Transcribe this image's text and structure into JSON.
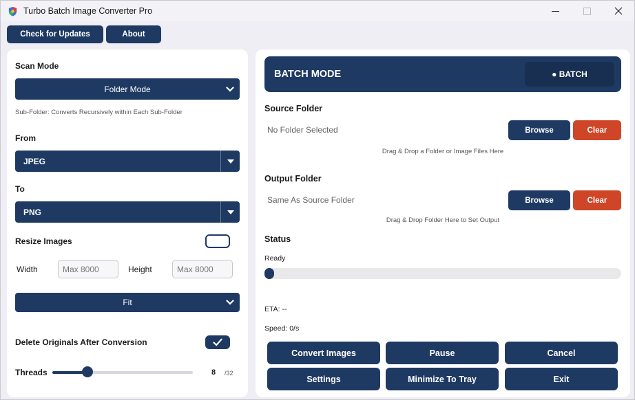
{
  "window": {
    "title": "Turbo Batch Image Converter Pro"
  },
  "top_buttons": {
    "check_updates": "Check for Updates",
    "about": "About"
  },
  "left": {
    "scan_mode_label": "Scan Mode",
    "scan_mode_value": "Folder Mode",
    "scan_mode_hint": "Sub-Folder: Converts Recursively within Each Sub-Folder",
    "from_label": "From",
    "from_value": "JPEG",
    "to_label": "To",
    "to_value": "PNG",
    "resize_label": "Resize Images",
    "resize_enabled": false,
    "width_label": "Width",
    "width_placeholder": "Max 8000",
    "height_label": "Height",
    "height_placeholder": "Max 8000",
    "fit_value": "Fit",
    "delete_originals_label": "Delete Originals After Conversion",
    "delete_originals_enabled": true,
    "threads_label": "Threads",
    "threads_value": "8",
    "threads_max": "/32",
    "threads_fraction": 0.25
  },
  "right": {
    "banner_title": "BATCH MODE",
    "batch_pill": "● BATCH",
    "source_label": "Source Folder",
    "source_value": "No Folder Selected",
    "source_browse": "Browse",
    "source_clear": "Clear",
    "source_hint": "Drag & Drop a Folder or Image Files Here",
    "output_label": "Output Folder",
    "output_value": "Same As Source Folder",
    "output_browse": "Browse",
    "output_clear": "Clear",
    "output_hint": "Drag & Drop Folder Here to Set Output",
    "status_label": "Status",
    "status_value": "Ready",
    "progress": 0,
    "eta": "ETA: --",
    "speed": "Speed: 0/s",
    "actions": {
      "convert": "Convert Images",
      "pause": "Pause",
      "cancel": "Cancel",
      "settings": "Settings",
      "minimize": "Minimize To Tray",
      "exit": "Exit"
    }
  },
  "colors": {
    "primary": "#1e3a63",
    "danger": "#cf4527",
    "background": "#efeef5"
  }
}
